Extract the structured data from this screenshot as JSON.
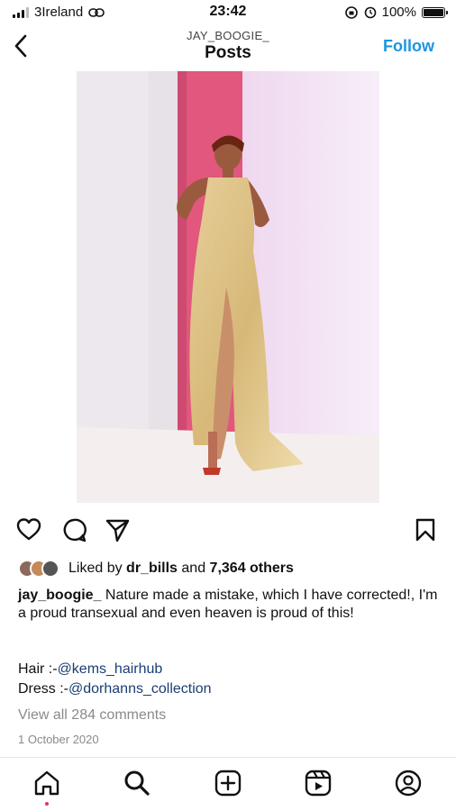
{
  "status_bar": {
    "carrier": "3Ireland",
    "time": "23:42",
    "battery": "100%"
  },
  "header": {
    "subtitle": "JAY_BOOGIE_",
    "title": "Posts",
    "follow_label": "Follow"
  },
  "post": {
    "liked_by_prefix": "Liked by ",
    "liked_by_user": "dr_bills",
    "liked_by_and": " and ",
    "liked_by_count": "7,364 others",
    "caption_user": "jay_boogie_",
    "caption_text": " Nature made a mistake, which I have corrected!, I'm a proud transexual and even heaven is proud of this!",
    "hair_prefix": "Hair :-",
    "hair_mention": "@kems_hairhub",
    "dress_prefix": "Dress :-",
    "dress_mention": "@dorhanns_collection",
    "view_comments": "View all 284 comments",
    "date": "1 October 2020"
  },
  "icons": {
    "actions": [
      "heart-icon",
      "comment-icon",
      "share-icon",
      "save-icon"
    ],
    "tabs": [
      "home-icon",
      "search-icon",
      "create-icon",
      "reels-icon",
      "profile-icon"
    ]
  },
  "colors": {
    "accent": "#1c95e0",
    "mention": "#1a3e73",
    "muted": "#8a8a8a",
    "notification_dot": "#e8325a"
  }
}
